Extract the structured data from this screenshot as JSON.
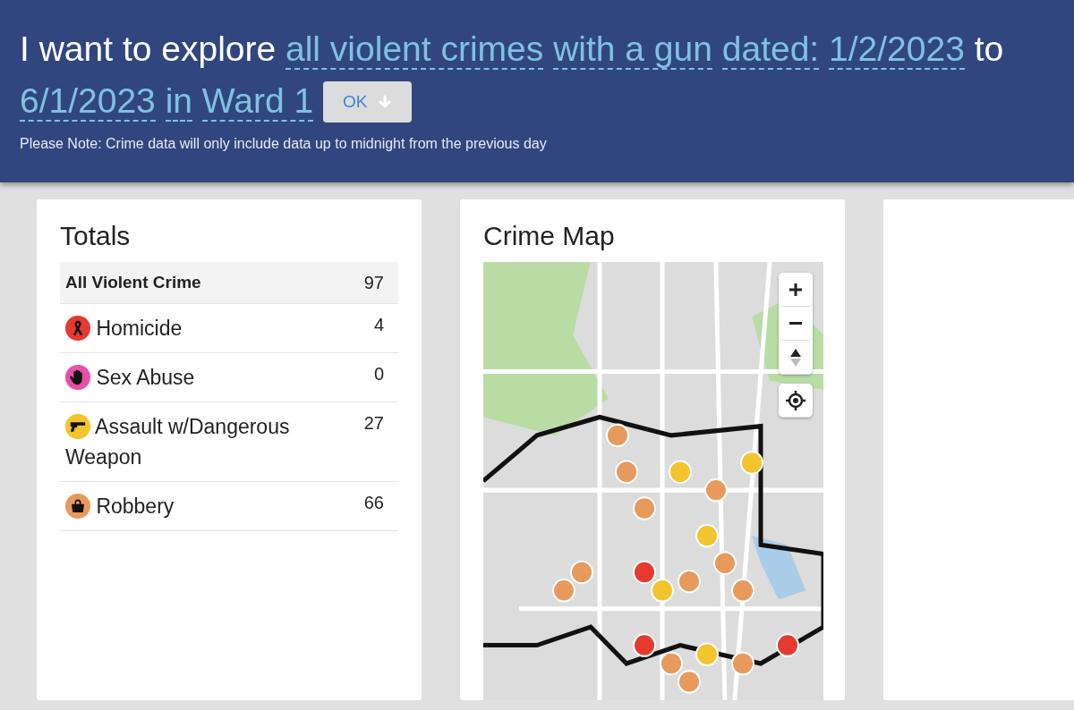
{
  "header": {
    "sentence": [
      {
        "text": "I want to explore",
        "kind": "plain"
      },
      {
        "text": "all violent crimes",
        "kind": "choice"
      },
      {
        "text": "with a gun",
        "kind": "choice"
      },
      {
        "text": "dated:",
        "kind": "choice"
      },
      {
        "text": "1/2/2023",
        "kind": "choice"
      },
      {
        "text": "to",
        "kind": "plain"
      },
      {
        "text": "6/1/2023",
        "kind": "choice"
      },
      {
        "text": "in",
        "kind": "choice"
      },
      {
        "text": "Ward 1",
        "kind": "choice"
      }
    ],
    "ok_button": "OK",
    "note": "Please Note: Crime data will only include data up to midnight from the previous day"
  },
  "totals": {
    "title": "Totals",
    "rows": [
      {
        "kind": "total",
        "label": "All Violent Crime",
        "count": "97"
      },
      {
        "kind": "homicide",
        "color": "#e53a2f",
        "label": "Homicide",
        "count": "4"
      },
      {
        "kind": "sexabuse",
        "color": "#e84fa6",
        "label": "Sex Abuse",
        "count": "0"
      },
      {
        "kind": "assault",
        "color": "#f2c52e",
        "label": "Assault w/Dangerous Weapon",
        "count": "27"
      },
      {
        "kind": "robbery",
        "color": "#e89a5c",
        "label": "Robbery",
        "count": "66"
      }
    ]
  },
  "map": {
    "title": "Crime Map"
  }
}
